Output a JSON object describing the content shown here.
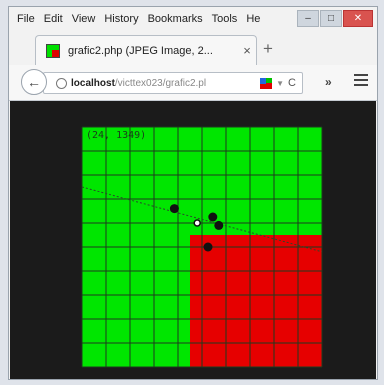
{
  "menubar": {
    "items": [
      "File",
      "Edit",
      "View",
      "History",
      "Bookmarks",
      "Tools",
      "He"
    ]
  },
  "window_controls": {
    "minimize": "–",
    "maximize": "□",
    "close": "✕"
  },
  "tab": {
    "title": "grafic2.php (JPEG Image, 2...",
    "close": "×",
    "new_tab": "+"
  },
  "navbar": {
    "back": "←",
    "url_host": "localhost",
    "url_path": "/victtex023/grafic2.pl",
    "reload": "C",
    "overflow": "»",
    "icons": [
      "back-arrow-icon",
      "globe-icon",
      "thumbnail-icon",
      "dropdown-icon",
      "reload-icon",
      "overflow-icon",
      "hamburger-menu-icon"
    ]
  },
  "image": {
    "coordinate_readout": "(24, 1349)",
    "colors": {
      "background": "#1b1b1b",
      "green": "#00e600",
      "red": "#e60000",
      "grid_line": "#1e3a1e",
      "point": "#111111"
    },
    "grid": {
      "columns": 10,
      "rows": 10,
      "red_region_from_col": 4.5,
      "red_region_from_row": 4.5
    },
    "points": [
      {
        "col": 3.85,
        "row": 3.4
      },
      {
        "col": 5.45,
        "row": 3.75
      },
      {
        "col": 5.7,
        "row": 4.1
      },
      {
        "col": 5.25,
        "row": 5.0
      }
    ],
    "marker": {
      "col": 4.8,
      "row": 4.0
    },
    "trend_line": {
      "from": {
        "col": 0,
        "row": 2.5
      },
      "to": {
        "col": 10,
        "row": 5.2
      }
    }
  }
}
